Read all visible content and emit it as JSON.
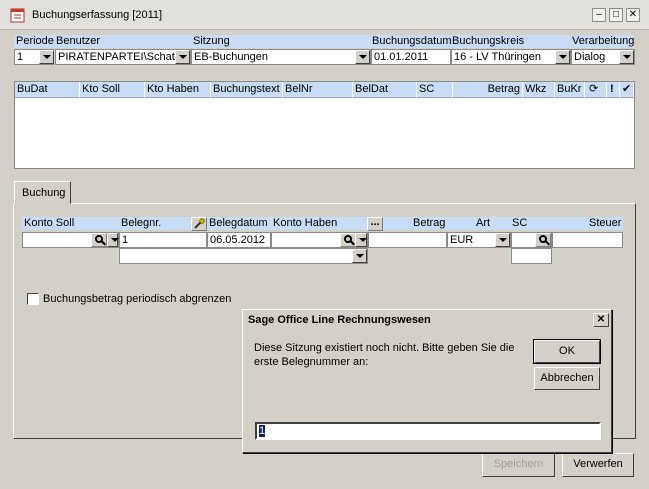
{
  "window": {
    "title": "Buchungserfassung [2011]"
  },
  "header": {
    "periode_label": "Periode",
    "benutzer_label": "Benutzer",
    "sitzung_label": "Sitzung",
    "buchungsdatum_label": "Buchungsdatum",
    "buchungskreis_label": "Buchungskreis",
    "verarbeitung_label": "Verarbeitung",
    "periode_value": "1",
    "benutzer_value": "PIRATENPARTEI\\Schatzm",
    "sitzung_value": "EB-Buchungen",
    "buchungsdatum_value": "01.01.2011",
    "buchungskreis_value": "16 - LV Thüringen",
    "verarbeitung_value": "Dialog"
  },
  "grid": {
    "columns": [
      "BuDat",
      "Kto Soll",
      "Kto Haben",
      "Buchungstext",
      "BelNr",
      "BelDat",
      "SC",
      "Betrag",
      "Wkz",
      "BuKr"
    ]
  },
  "tabs": {
    "buchung_label": "Buchung"
  },
  "form": {
    "konto_soll_label": "Konto Soll",
    "belegnr_label": "Belegnr.",
    "belegdatum_label": "Belegdatum",
    "konto_haben_label": "Konto Haben",
    "betrag_label": "Betrag",
    "art_label": "Art",
    "sc_label": "SC",
    "steuer_label": "Steuer",
    "belegnr_value": "1",
    "belegdatum_value": "06.05.2012",
    "currency_value": "EUR",
    "ellipsis_label": "...",
    "abgrenzen_label": "Buchungsbetrag periodisch abgrenzen"
  },
  "dialog": {
    "title": "Sage Office Line Rechnungswesen",
    "message": "Diese Sitzung existiert noch nicht. Bitte geben Sie die erste Belegnummer an:",
    "ok_label": "OK",
    "cancel_label": "Abbrechen",
    "input_value": "1",
    "close_label": "✕"
  },
  "footer": {
    "save_label": "Speichern",
    "discard_label": "Verwerfen"
  }
}
